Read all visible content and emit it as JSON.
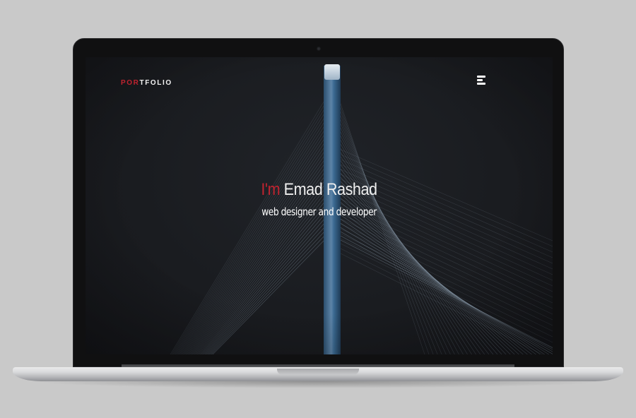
{
  "site": {
    "brand": {
      "accent_text": "POR",
      "rest_text": "TFOLIO"
    },
    "menu_icon": "hamburger-icon",
    "hero": {
      "prefix": "I'm",
      "name": " Emad Rashad",
      "subtitle": "web designer and developer"
    }
  },
  "colors": {
    "accent": "#c0232f",
    "background": "#1a1c20",
    "text": "#ffffff",
    "device_backdrop": "#c9c9c9"
  }
}
